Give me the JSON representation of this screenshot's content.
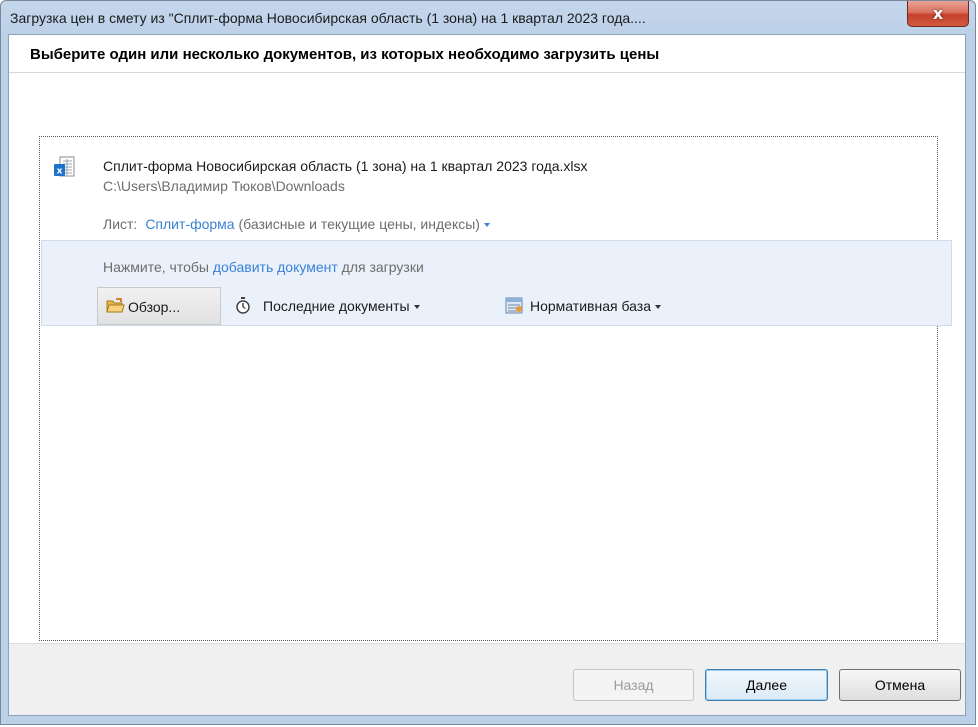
{
  "window": {
    "title": "Загрузка цен в смету из \"Сплит-форма Новосибирская область (1 зона) на 1 квартал 2023 года....",
    "close_label": "x"
  },
  "heading": "Выберите один или несколько документов, из которых необходимо загрузить цены",
  "document": {
    "icon": "excel-file-icon",
    "name": "Сплит-форма Новосибирская область (1 зона) на 1 квартал 2023 года.xlsx",
    "path": "C:\\Users\\Владимир Тюков\\Downloads",
    "sheet_label": "Лист:",
    "sheet_link": "Сплит-форма",
    "sheet_desc": " (базисные и текущие цены, индексы)"
  },
  "add": {
    "prefix": "Нажмите, чтобы ",
    "link": "добавить документ",
    "suffix": " для загрузки"
  },
  "toolbar": {
    "browse_label": "Обзор...",
    "recent_label": "Последние документы",
    "normative_label": "Нормативная база"
  },
  "footer": {
    "back_label": "Назад",
    "next_label": "Далее",
    "cancel_label": "Отмена"
  },
  "colors": {
    "link": "#3a82d6",
    "titlebar": "#c5d7ec",
    "add_panel": "#eaf1fa",
    "close": "#c4412b"
  }
}
